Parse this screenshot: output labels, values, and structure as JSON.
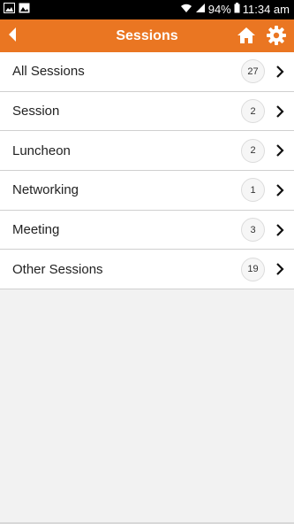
{
  "status_bar": {
    "battery": "94%",
    "time": "11:34 am",
    "icons": [
      "gallery-icon",
      "photo-icon",
      "wifi-icon",
      "signal-icon",
      "battery-icon"
    ]
  },
  "app_bar": {
    "title": "Sessions",
    "color": "#ea7622",
    "icons": [
      "back-icon",
      "home-icon",
      "gear-icon"
    ]
  },
  "sessions": [
    {
      "label": "All Sessions",
      "count": "27"
    },
    {
      "label": "Session",
      "count": "2"
    },
    {
      "label": "Luncheon",
      "count": "2"
    },
    {
      "label": "Networking",
      "count": "1"
    },
    {
      "label": "Meeting",
      "count": "3"
    },
    {
      "label": "Other Sessions",
      "count": "19"
    }
  ]
}
